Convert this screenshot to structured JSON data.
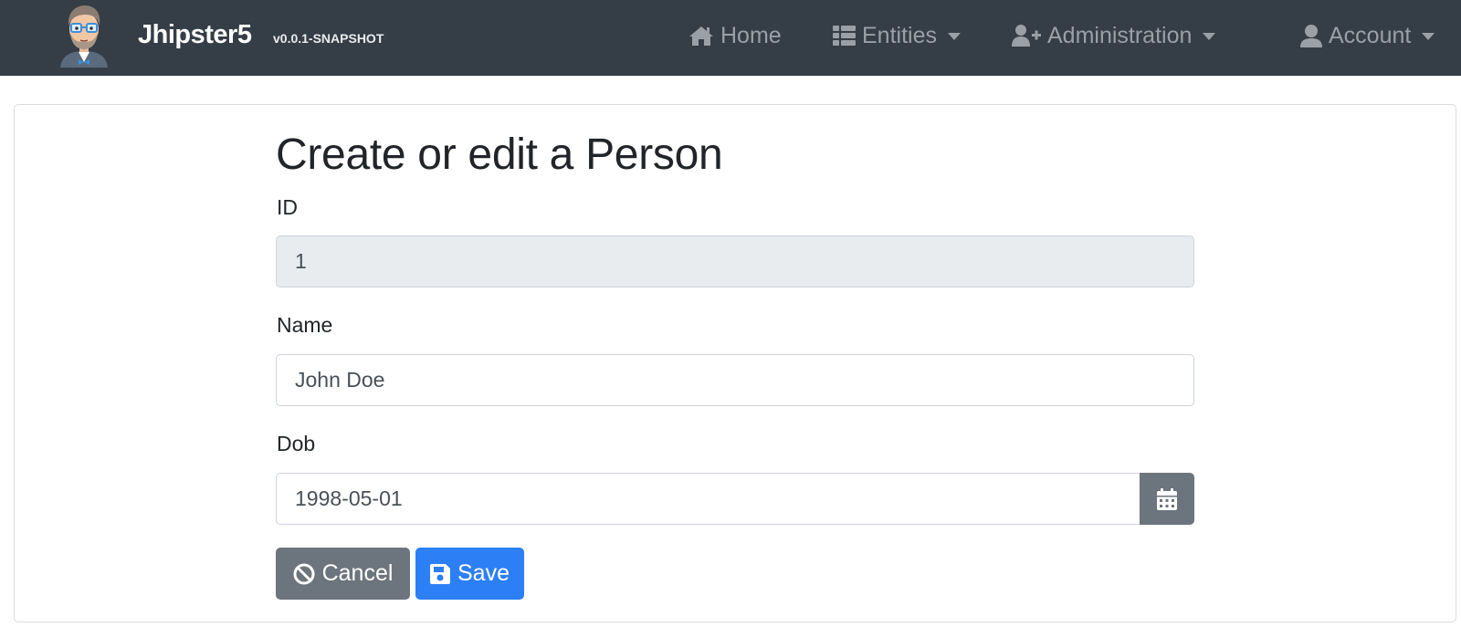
{
  "navbar": {
    "brand_name": "Jhipster5",
    "brand_version": "v0.0.1-SNAPSHOT",
    "items": [
      {
        "label": "Home",
        "icon": "home-icon",
        "has_caret": false
      },
      {
        "label": "Entities",
        "icon": "list-icon",
        "has_caret": true
      },
      {
        "label": "Administration",
        "icon": "user-plus-icon",
        "has_caret": true
      },
      {
        "label": "Account",
        "icon": "user-icon",
        "has_caret": true
      }
    ],
    "colors": {
      "background": "#353d47",
      "item_text": "#9aa0a7"
    }
  },
  "form": {
    "title": "Create or edit a Person",
    "fields": [
      {
        "label": "ID",
        "value": "1",
        "readonly": true
      },
      {
        "label": "Name",
        "value": "John Doe",
        "readonly": false
      },
      {
        "label": "Dob",
        "value": "1998-05-01",
        "readonly": false,
        "icon": "calendar-icon"
      }
    ],
    "buttons": {
      "cancel": {
        "label": "Cancel",
        "icon": "ban-icon",
        "color": "#6c757d"
      },
      "save": {
        "label": "Save",
        "icon": "save-icon",
        "color": "#2d7ff5"
      }
    }
  }
}
